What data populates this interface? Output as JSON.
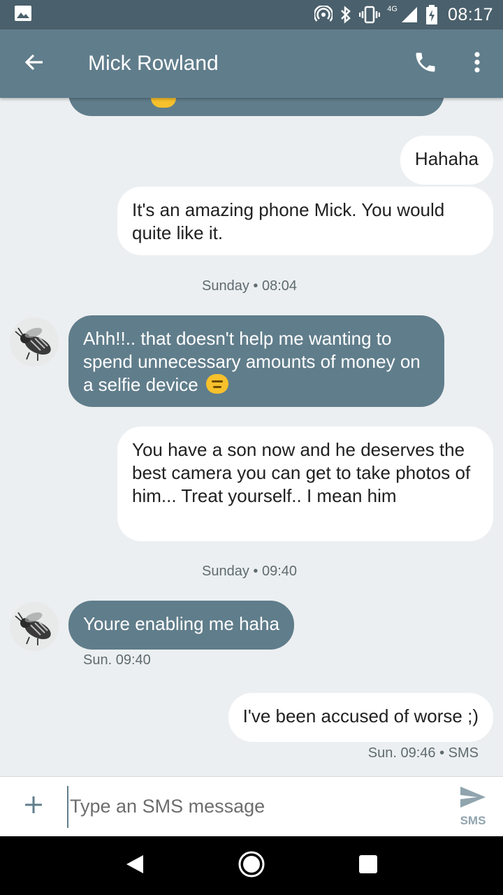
{
  "status_bar": {
    "network_label": "4G",
    "time": "08:17"
  },
  "header": {
    "contact_name": "Mick Rowland"
  },
  "messages": [
    {
      "direction": "out",
      "text": "Hahaha"
    },
    {
      "direction": "out",
      "text": "It's an amazing phone Mick. You would quite like it."
    },
    {
      "type": "divider",
      "text": "Sunday • 08:04"
    },
    {
      "direction": "in",
      "text": "Ahh!!.. that doesn't help me wanting to spend unnecessary amounts of money on a selfie device"
    },
    {
      "direction": "out",
      "text": "You have a son now and he deserves the best camera you can get to take photos of him... Treat yourself.. I mean him"
    },
    {
      "type": "divider",
      "text": "Sunday • 09:40"
    },
    {
      "direction": "in",
      "text": "Youre enabling me haha",
      "meta": "Sun. 09:40"
    },
    {
      "direction": "out",
      "text": "I've been accused of worse ;)",
      "meta": "Sun. 09:46 • SMS"
    }
  ],
  "compose": {
    "placeholder": "Type an SMS message",
    "send_label": "SMS"
  },
  "colors": {
    "status_bar": "#4a606c",
    "app_bar": "#607d8b",
    "incoming_bubble": "#607d8b",
    "outgoing_bubble": "#ffffff",
    "background": "#eceff1"
  }
}
